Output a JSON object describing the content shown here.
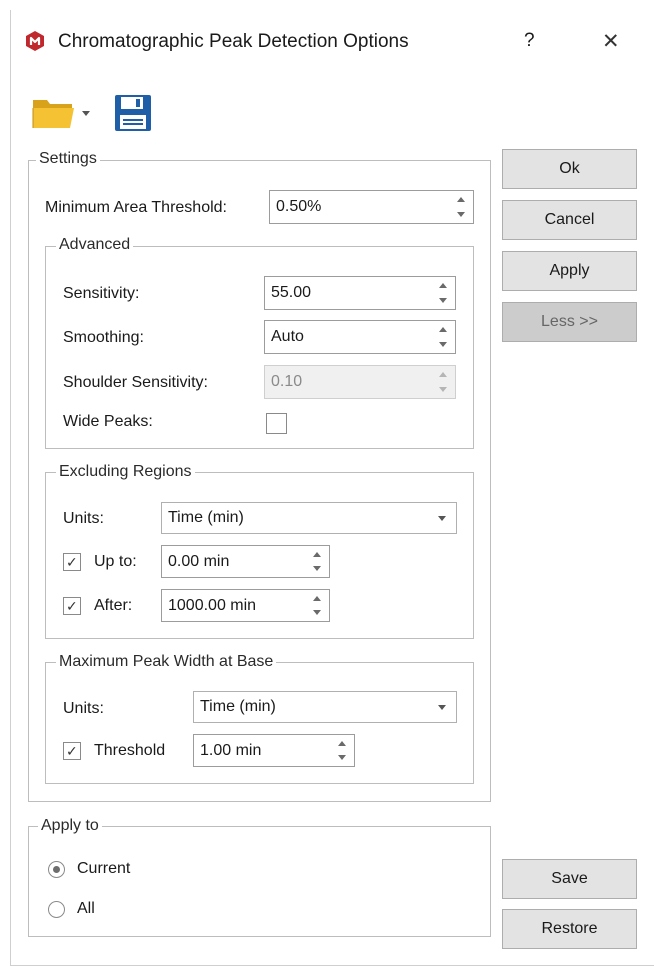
{
  "window": {
    "title": "Chromatographic Peak Detection Options",
    "help_label": "?",
    "close_label": "✕",
    "app_icon_color": "#c0282d"
  },
  "toolbar": {
    "open_icon": "folder-open-icon",
    "save_icon": "floppy-disk-icon"
  },
  "settings": {
    "legend": "Settings",
    "min_area_label": "Minimum Area Threshold:",
    "min_area_value": "0.50%",
    "advanced": {
      "legend": "Advanced",
      "sensitivity_label": "Sensitivity:",
      "sensitivity_value": "55.00",
      "smoothing_label": "Smoothing:",
      "smoothing_value": "Auto",
      "shoulder_label": "Shoulder Sensitivity:",
      "shoulder_value": "0.10",
      "wide_peaks_label": "Wide Peaks:",
      "wide_peaks_checked": false
    },
    "excluding": {
      "legend": "Excluding Regions",
      "units_label": "Units:",
      "units_value": "Time (min)",
      "upto_label": "Up to:",
      "upto_checked": true,
      "upto_value": "0.00 min",
      "after_label": "After:",
      "after_checked": true,
      "after_value": "1000.00 min"
    },
    "max_width": {
      "legend": "Maximum Peak Width at Base",
      "units_label": "Units:",
      "units_value": "Time (min)",
      "threshold_label": "Threshold",
      "threshold_checked": true,
      "threshold_value": "1.00 min"
    }
  },
  "apply_to": {
    "legend": "Apply to",
    "current_label": "Current",
    "all_label": "All",
    "selected": "Current"
  },
  "buttons": {
    "ok": "Ok",
    "cancel": "Cancel",
    "apply": "Apply",
    "less": "Less >>",
    "save": "Save",
    "restore": "Restore"
  }
}
